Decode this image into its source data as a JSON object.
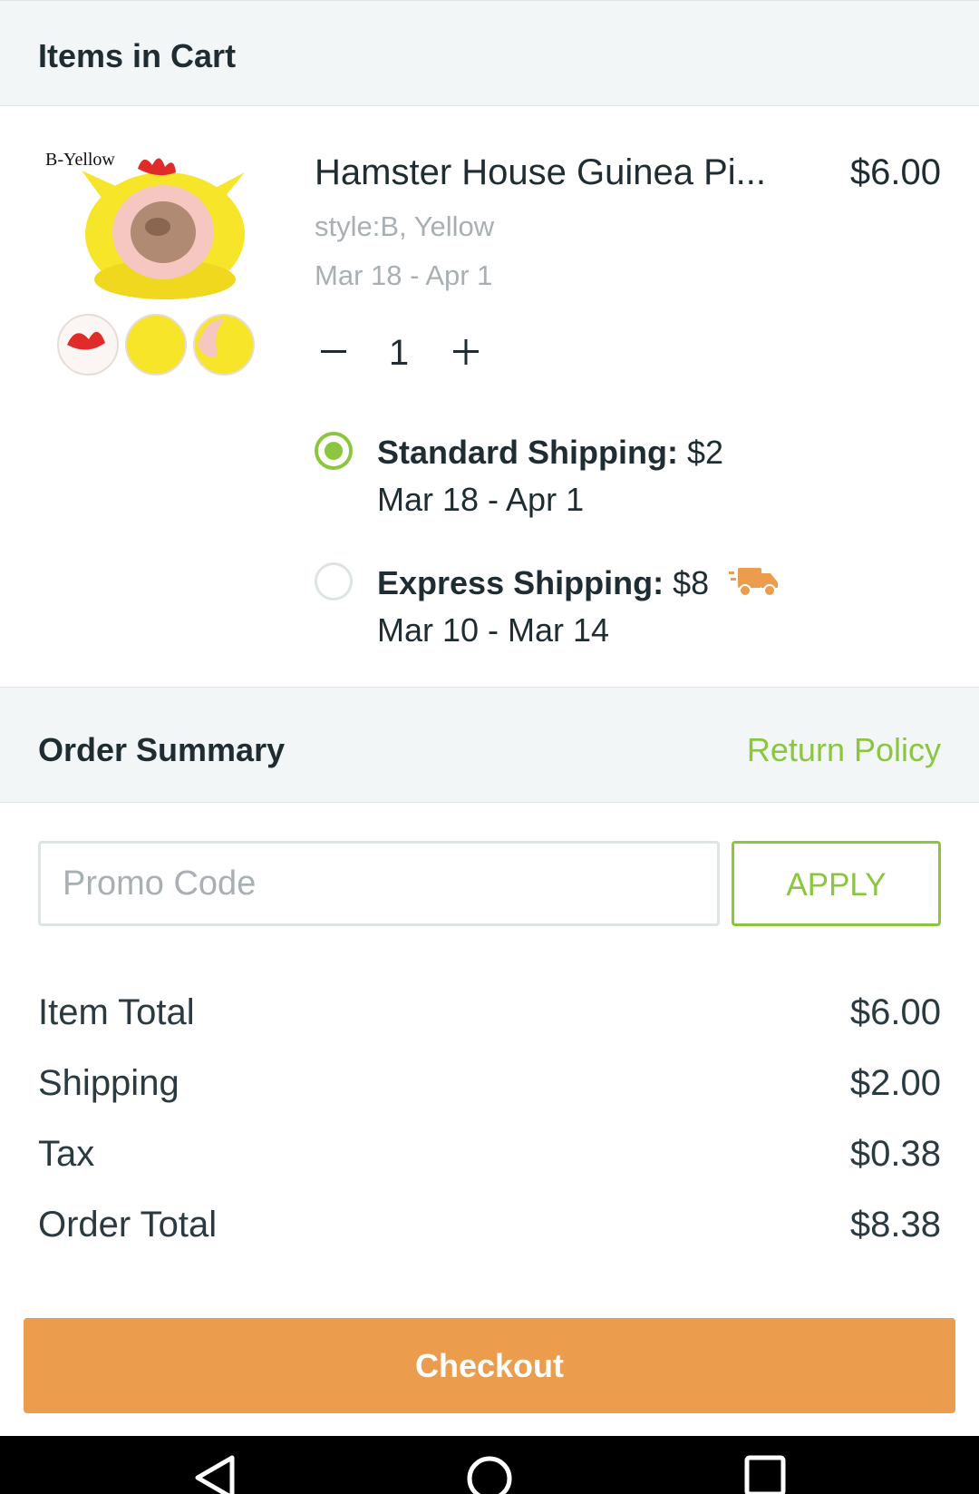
{
  "cart_header": {
    "title": "Items in Cart"
  },
  "product": {
    "image_label": "B-Yellow",
    "title": "Hamster House Guinea Pi...",
    "price": "$6.00",
    "style": "style:B, Yellow",
    "dates": "Mar 18 - Apr 1",
    "quantity": "1"
  },
  "shipping": {
    "standard": {
      "label": "Standard Shipping:",
      "price": "$2",
      "dates": "Mar 18 - Apr 1",
      "selected": true
    },
    "express": {
      "label": "Express Shipping:",
      "price": "$8",
      "dates": "Mar 10 - Mar 14",
      "selected": false,
      "icon": "truck-icon"
    }
  },
  "summary_header": {
    "title": "Order Summary",
    "return_policy": "Return Policy"
  },
  "promo": {
    "placeholder": "Promo Code",
    "value": "",
    "apply_label": "APPLY"
  },
  "totals": {
    "item_total": {
      "label": "Item Total",
      "value": "$6.00"
    },
    "shipping": {
      "label": "Shipping",
      "value": "$2.00"
    },
    "tax": {
      "label": "Tax",
      "value": "$0.38"
    },
    "order_total": {
      "label": "Order Total",
      "value": "$8.38"
    }
  },
  "checkout": {
    "label": "Checkout"
  },
  "nav": {
    "icons": [
      "back-icon",
      "home-icon",
      "recents-icon"
    ]
  },
  "colors": {
    "accent_green": "#8cc63f",
    "checkout_orange": "#eb9c4d",
    "header_bg": "#f2f6f7"
  }
}
